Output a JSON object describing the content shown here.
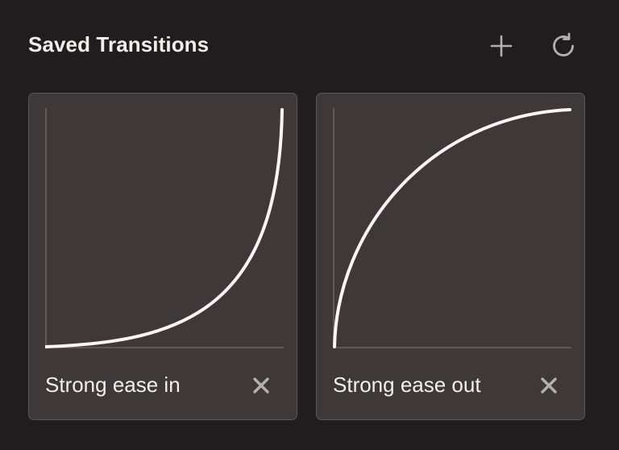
{
  "header": {
    "title": "Saved Transitions",
    "add_icon": "plus-icon",
    "reset_icon": "refresh-icon"
  },
  "colors": {
    "background": "#1f1d1d",
    "card": "#3f3838",
    "card_border": "#5b5555",
    "curve": "#fdf3f3",
    "axis": "#6a6363",
    "icon": "#b5b0b0"
  },
  "transitions": [
    {
      "label": "Strong ease in",
      "curve": "ease-in",
      "delete_icon": "close-icon"
    },
    {
      "label": "Strong ease out",
      "curve": "ease-out",
      "delete_icon": "close-icon"
    }
  ]
}
